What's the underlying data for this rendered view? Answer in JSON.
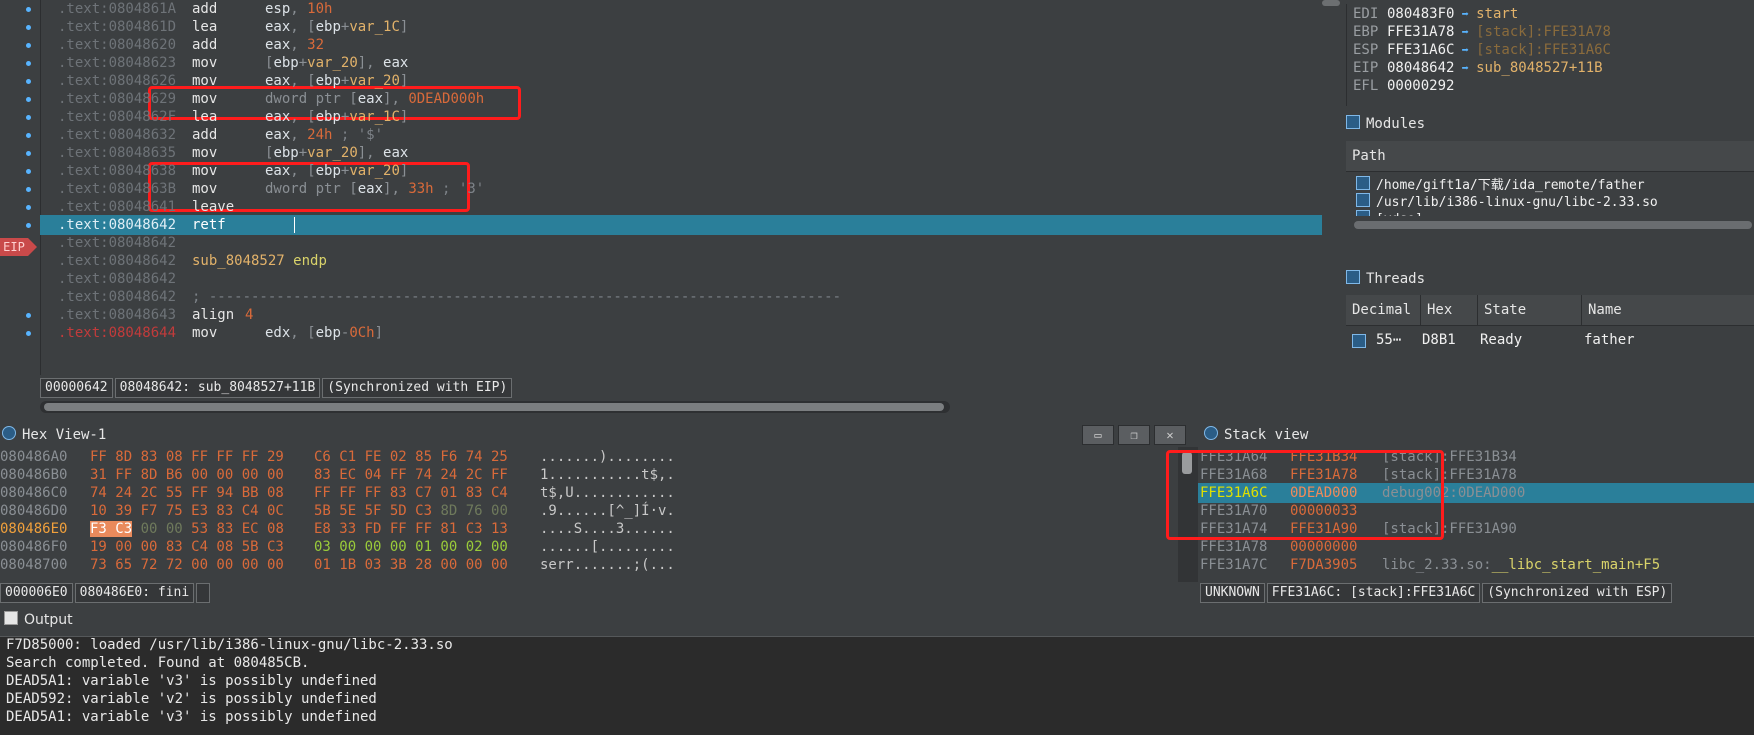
{
  "disasm": {
    "lines": [
      {
        "addr": ".text:0804861A",
        "mnem": "add",
        "ops_html": "esp, <span class=\"num\">10h</span>"
      },
      {
        "addr": ".text:0804861D",
        "mnem": "lea",
        "ops_html": "eax, [ebp+<span class=\"lbl\">var_1C</span>]"
      },
      {
        "addr": ".text:08048620",
        "mnem": "add",
        "ops_html": "eax, <span class=\"num\">32</span>"
      },
      {
        "addr": ".text:08048623",
        "mnem": "mov",
        "ops_html": "[ebp+<span class=\"lbl\">var_20</span>], eax"
      },
      {
        "addr": ".text:08048626",
        "mnem": "mov",
        "ops_html": "eax, [ebp+<span class=\"lbl\">var_20</span>]"
      },
      {
        "addr": ".text:08048629",
        "mnem": "mov",
        "ops_html": "dword ptr [eax], <span class=\"num\">0DEAD000h</span>"
      },
      {
        "addr": ".text:0804862F",
        "mnem": "lea",
        "ops_html": "eax, [ebp+<span class=\"lbl\">var_1C</span>]"
      },
      {
        "addr": ".text:08048632",
        "mnem": "add",
        "ops_html": "eax, <span class=\"num\">24h</span> <span class=\"cmt\">; '$'</span>"
      },
      {
        "addr": ".text:08048635",
        "mnem": "mov",
        "ops_html": "[ebp+<span class=\"lbl\">var_20</span>], eax"
      },
      {
        "addr": ".text:08048638",
        "mnem": "mov",
        "ops_html": "eax, [ebp+<span class=\"lbl\">var_20</span>]"
      },
      {
        "addr": ".text:0804863B",
        "mnem": "mov",
        "ops_html": "dword ptr [eax], <span class=\"num\">33h</span> <span class=\"cmt\">; '3'</span>"
      },
      {
        "addr": ".text:08048641",
        "mnem": "leave",
        "ops_html": ""
      },
      {
        "addr": ".text:08048642",
        "mnem": "retf",
        "ops_html": "",
        "current": true
      },
      {
        "addr": ".text:08048642",
        "mnem": "",
        "ops_html": ""
      },
      {
        "addr": ".text:08048642",
        "mnem": "",
        "ops_html": "",
        "full_html": "<span class=\"lbl\">sub_8048527</span> <span class=\"kw\">endp</span>"
      },
      {
        "addr": ".text:08048642",
        "mnem": "",
        "ops_html": ""
      },
      {
        "addr": ".text:08048642",
        "mnem": "",
        "ops_html": "",
        "full_html": "<span class=\"cmt\">; ---------------------------------------------------------------------------</span>"
      },
      {
        "addr": ".text:08048643",
        "mnem": "align",
        "ops_html": "<span class=\"num\">4</span>",
        "tight": true
      },
      {
        "addr": ".text:08048644",
        "mnem": "mov",
        "ops_html": "edx, [ebp-<span class=\"num\">0Ch</span>]",
        "red": true
      }
    ],
    "eip_tag": "EIP",
    "status": [
      "00000642",
      "08048642: sub_8048527+11B",
      "(Synchronized with EIP)"
    ]
  },
  "registers": [
    {
      "name": "EDI",
      "value": "080483F0",
      "arrow": "➡",
      "target": "start"
    },
    {
      "name": "EBP",
      "value": "FFE31A78",
      "arrow": "➡",
      "target": "[stack]:FFE31A78",
      "dim": true
    },
    {
      "name": "ESP",
      "value": "FFE31A6C",
      "arrow": "➡",
      "target": "[stack]:FFE31A6C",
      "dim": true
    },
    {
      "name": "EIP",
      "value": "08048642",
      "arrow": "➡",
      "target": "sub_8048527+11B"
    },
    {
      "name": "EFL",
      "value": "00000292",
      "arrow": "",
      "target": ""
    }
  ],
  "modules": {
    "title": "Modules",
    "header": "Path",
    "rows": [
      "/home/gift1a/下载/ida_remote/father",
      "/usr/lib/i386-linux-gnu/libc-2.33.so",
      "[vdso]"
    ]
  },
  "threads": {
    "title": "Threads",
    "columns": [
      "Decimal",
      "Hex",
      "State",
      "Name"
    ],
    "rows": [
      {
        "decimal": "55⋯",
        "hex": "D8B1",
        "state": "Ready",
        "name": "father"
      }
    ]
  },
  "hex": {
    "title": "Hex View-1",
    "rows": [
      {
        "addr": "080486A0",
        "b1": "FF 8D 83 08 FF FF FF 29",
        "b2": "C6 C1 FE 02 85 F6 74 25",
        "ascii": ".......)........"
      },
      {
        "addr": "080486B0",
        "b1": "31 FF 8D B6 00 00 00 00",
        "b2": "83 EC 04 FF 74 24 2C FF",
        "ascii": "1...........t$,."
      },
      {
        "addr": "080486C0",
        "b1": "74 24 2C 55 FF 94 BB 08",
        "b2": "FF FF FF 83 C7 01 83 C4",
        "ascii": "t$,U............"
      },
      {
        "addr": "080486D0",
        "b1": "10 39 F7 75 E3 83 C4 0C",
        "b2": "5B 5E 5F 5D C3 8D 76 00",
        "ascii": ".9......[^_]Í·v."
      },
      {
        "addr": "080486E0",
        "b1": "F3 C3 00 00 53 83 EC 08",
        "b2": "E8 33 FD FF FF 81 C3 13",
        "ascii": "....S....3......",
        "highlight": true
      },
      {
        "addr": "080486F0",
        "b1": "19 00 00 83 C4 08 5B C3",
        "b2": "03 00 00 00 01 00 02 00",
        "ascii": "......[........."
      },
      {
        "addr": "08048700",
        "b1": "73 65 72 72 00 00 00 00",
        "b2": "01 1B 03 3B 28 00 00 00",
        "ascii": "serr.......;(..."
      }
    ],
    "status": [
      "000006E0",
      "080486E0: fini",
      ""
    ]
  },
  "stack": {
    "title": "Stack view",
    "rows": [
      {
        "addr": "FFE31A64",
        "val": "FFE31B34",
        "cmt": "[stack]:FFE31B34"
      },
      {
        "addr": "FFE31A68",
        "val": "FFE31A78",
        "cmt": "[stack]:FFE31A78"
      },
      {
        "addr": "FFE31A6C",
        "val": "0DEAD000",
        "cmt": "debug002:0DEAD000",
        "current": true
      },
      {
        "addr": "FFE31A70",
        "val": "00000033",
        "cmt": ""
      },
      {
        "addr": "FFE31A74",
        "val": "FFE31A90",
        "cmt": "[stack]:FFE31A90"
      },
      {
        "addr": "FFE31A78",
        "val": "00000000",
        "cmt": ""
      },
      {
        "addr": "FFE31A7C",
        "val": "F7DA3905",
        "cmt": "libc_2.33.so:__libc_start_main+F5"
      }
    ],
    "status": [
      "UNKNOWN",
      "FFE31A6C: [stack]:FFE31A6C",
      "(Synchronized with ESP)"
    ]
  },
  "output": {
    "title": "Output",
    "lines": [
      "F7D85000: loaded /usr/lib/i386-linux-gnu/libc-2.33.so",
      "Search completed. Found at 080485CB.",
      "DEAD5A1: variable 'v3' is possibly undefined",
      "DEAD592: variable 'v2' is possibly undefined",
      "DEAD5A1: variable 'v3' is possibly undefined"
    ]
  },
  "colors": {
    "accent": "#2a7f9a",
    "highlight_box": "#ff1c1c",
    "eip_marker": "#c94a4a"
  }
}
